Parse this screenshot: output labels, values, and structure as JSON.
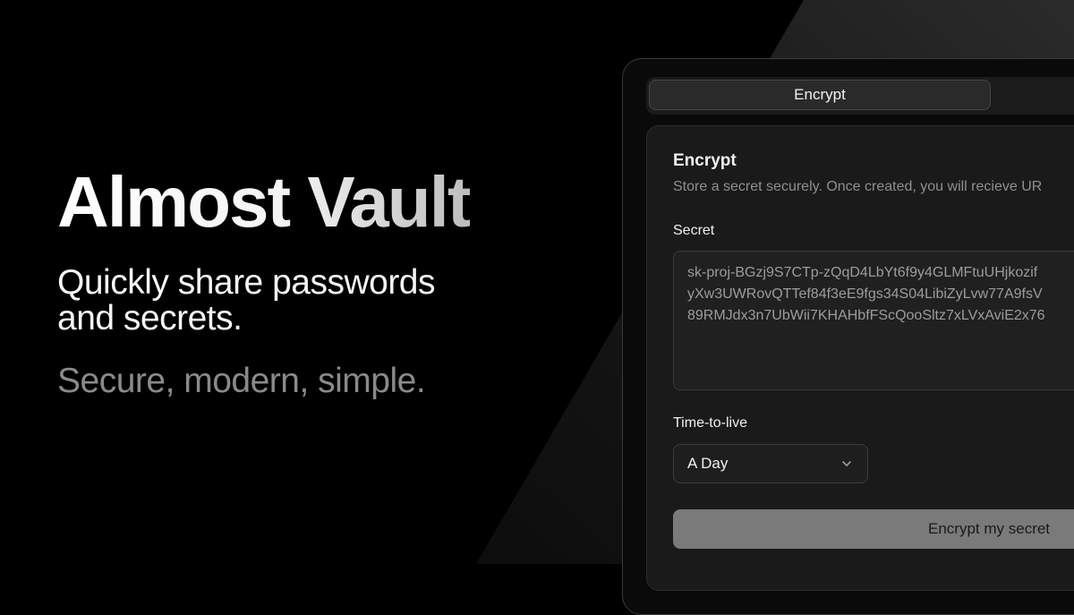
{
  "hero": {
    "title": "Almost Vault",
    "tagline": "Quickly share passwords and secrets.",
    "subtitle": "Secure, modern, simple."
  },
  "tabs": [
    {
      "label": "Encrypt",
      "active": true
    }
  ],
  "card": {
    "title": "Encrypt",
    "description": "Store a secret securely. Once created, you will recieve UR"
  },
  "secret": {
    "label": "Secret",
    "value_lines": [
      "sk-proj-BGzj9S7CTp-zQqD4LbYt6f9y4GLMFtuUHjkozif",
      "yXw3UWRovQTTef84f3eE9fgs34S04LibiZyLvw77A9fsV",
      "89RMJdx3n7UbWii7KHAHbfFScQooSltz7xLVxAviE2x76"
    ]
  },
  "ttl": {
    "label": "Time-to-live",
    "selected": "A Day"
  },
  "submit": {
    "label": "Encrypt my secret"
  },
  "colors": {
    "background": "#000000",
    "card": "#1a1a1a",
    "button": "#7a7a7a",
    "muted_text": "#8a8a8a"
  },
  "icons": {
    "select": "chevron-down-icon"
  }
}
